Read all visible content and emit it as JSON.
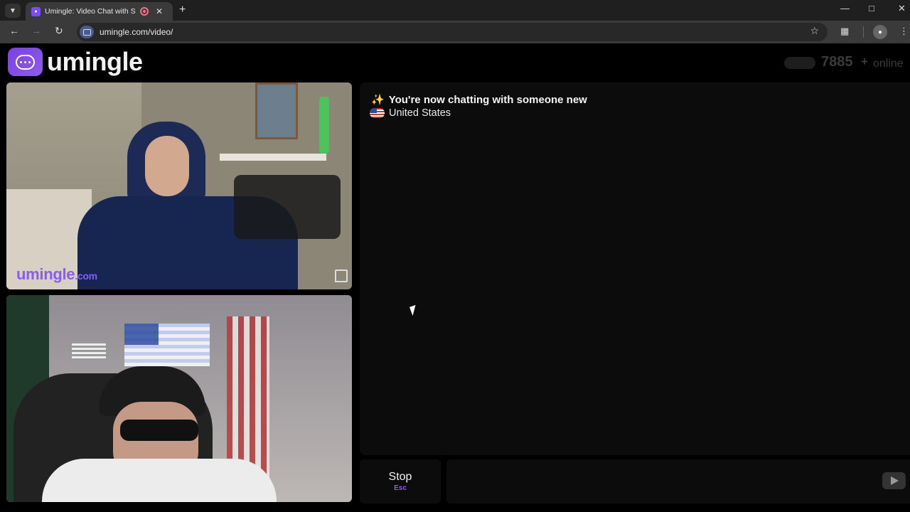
{
  "browser": {
    "tab_title": "Umingle: Video Chat with Strangers",
    "url": "umingle.com/video/",
    "icons": [
      "tab-search-icon",
      "favicon-icon",
      "recording-icon",
      "close-icon",
      "new-tab-icon",
      "minimize-icon",
      "maximize-icon",
      "close-window-icon",
      "back-icon",
      "forward-icon",
      "reload-icon",
      "bookmark-star-icon",
      "extensions-icon",
      "profile-icon",
      "menu-icon"
    ]
  },
  "header": {
    "logo_text": "umingle",
    "online_count": "7885",
    "online_plus": "+",
    "online_label": "online"
  },
  "video": {
    "watermark_brand": "umingle",
    "watermark_tld": ".com"
  },
  "chat": {
    "status_message": "You're now chatting with someone new",
    "country": "United States"
  },
  "controls": {
    "stop_label": "Stop",
    "stop_shortcut": "Esc"
  },
  "colors": {
    "brand": "#8a5cf5",
    "background": "#000000",
    "panel": "#0c0c0c"
  }
}
